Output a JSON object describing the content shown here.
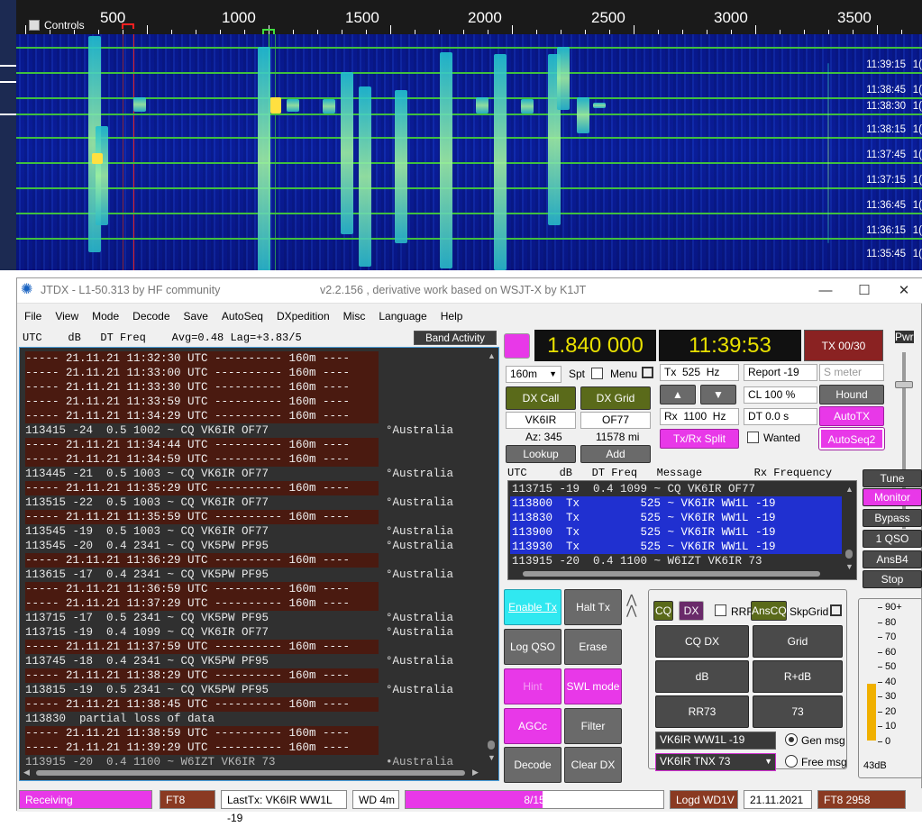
{
  "waterfall": {
    "controls_label": "Controls",
    "ticks": [
      "500",
      "1000",
      "1500",
      "2000",
      "2500",
      "3000",
      "3500"
    ],
    "times": [
      "11:39:15",
      "11:38:45",
      "11:38:30",
      "11:38:15",
      "11:37:45",
      "11:37:15",
      "11:36:45",
      "11:36:15",
      "11:35:45"
    ],
    "time_suffix": "1("
  },
  "window": {
    "title": "JTDX - L1-50.313  by HF community",
    "subtitle": "v2.2.156 , derivative work based on WSJT-X by K1JT",
    "minimize": "—",
    "maximize": "☐",
    "close": "✕"
  },
  "menu": [
    "File",
    "View",
    "Mode",
    "Decode",
    "Save",
    "AutoSeq",
    "DXpedition",
    "Misc",
    "Language",
    "Help"
  ],
  "decode_panel": {
    "header": "UTC    dB   DT Freq    Avg=0.48 Lag=+3.83/5",
    "band_activity": "Band Activity",
    "lines": [
      {
        "text": "----- 21.11.21 11:32:30 UTC ---------- 160m ----",
        "sep": true,
        "country": ""
      },
      {
        "text": "----- 21.11.21 11:33:00 UTC ---------- 160m ----",
        "sep": true,
        "country": ""
      },
      {
        "text": "----- 21.11.21 11:33:30 UTC ---------- 160m ----",
        "sep": true,
        "country": ""
      },
      {
        "text": "----- 21.11.21 11:33:59 UTC ---------- 160m ----",
        "sep": true,
        "country": ""
      },
      {
        "text": "----- 21.11.21 11:34:29 UTC ---------- 160m ----",
        "sep": true,
        "country": ""
      },
      {
        "text": "113415 -24  0.5 1002 ~ CQ VK6IR OF77",
        "sep": false,
        "country": "°Australia"
      },
      {
        "text": "----- 21.11.21 11:34:44 UTC ---------- 160m ----",
        "sep": true,
        "country": ""
      },
      {
        "text": "----- 21.11.21 11:34:59 UTC ---------- 160m ----",
        "sep": true,
        "country": ""
      },
      {
        "text": "113445 -21  0.5 1003 ~ CQ VK6IR OF77",
        "sep": false,
        "country": "°Australia"
      },
      {
        "text": "----- 21.11.21 11:35:29 UTC ---------- 160m ----",
        "sep": true,
        "country": ""
      },
      {
        "text": "113515 -22  0.5 1003 ~ CQ VK6IR OF77",
        "sep": false,
        "country": "°Australia"
      },
      {
        "text": "----- 21.11.21 11:35:59 UTC ---------- 160m ----",
        "sep": true,
        "country": ""
      },
      {
        "text": "113545 -19  0.5 1003 ~ CQ VK6IR OF77",
        "sep": false,
        "country": "°Australia"
      },
      {
        "text": "113545 -20  0.4 2341 ~ CQ VK5PW PF95",
        "sep": false,
        "country": "°Australia"
      },
      {
        "text": "----- 21.11.21 11:36:29 UTC ---------- 160m ----",
        "sep": true,
        "country": ""
      },
      {
        "text": "113615 -17  0.4 2341 ~ CQ VK5PW PF95",
        "sep": false,
        "country": "°Australia"
      },
      {
        "text": "----- 21.11.21 11:36:59 UTC ---------- 160m ----",
        "sep": true,
        "country": ""
      },
      {
        "text": "----- 21.11.21 11:37:29 UTC ---------- 160m ----",
        "sep": true,
        "country": ""
      },
      {
        "text": "113715 -17  0.5 2341 ~ CQ VK5PW PF95",
        "sep": false,
        "country": "°Australia"
      },
      {
        "text": "113715 -19  0.4 1099 ~ CQ VK6IR OF77",
        "sep": false,
        "country": "°Australia"
      },
      {
        "text": "----- 21.11.21 11:37:59 UTC ---------- 160m ----",
        "sep": true,
        "country": ""
      },
      {
        "text": "113745 -18  0.4 2341 ~ CQ VK5PW PF95",
        "sep": false,
        "country": "°Australia"
      },
      {
        "text": "----- 21.11.21 11:38:29 UTC ---------- 160m ----",
        "sep": true,
        "country": ""
      },
      {
        "text": "113815 -19  0.5 2341 ~ CQ VK5PW PF95",
        "sep": false,
        "country": "°Australia"
      },
      {
        "text": "----- 21.11.21 11:38:45 UTC ---------- 160m ----",
        "sep": true,
        "country": ""
      },
      {
        "text": "113830  partial loss of data",
        "sep": false,
        "country": ""
      },
      {
        "text": "----- 21.11.21 11:38:59 UTC ---------- 160m ----",
        "sep": true,
        "country": ""
      },
      {
        "text": "----- 21.11.21 11:39:29 UTC ---------- 160m ----",
        "sep": true,
        "country": ""
      },
      {
        "text": "113915 -20  0.4 1100 ~ W6IZT VK6IR 73",
        "sep": false,
        "country": "•Australia"
      }
    ]
  },
  "radio": {
    "frequency": "1.840 000",
    "clock": "11:39:53",
    "tx_counter": "TX 00/30",
    "band": "160m",
    "spt": "Spt",
    "menu": "Menu",
    "tx_freq": "Tx  525  Hz",
    "rx_freq": "Rx  1100  Hz",
    "report": "Report -19",
    "s_meter": "S meter",
    "cl": "CL  100 %",
    "dt": "DT 0.0 s",
    "hound": "Hound",
    "auto_tx": "AutoTX",
    "auto_seq2": "AutoSeq2",
    "wanted": "Wanted",
    "tx_rx_split": "Tx/Rx Split",
    "dx_call_btn": "DX Call",
    "dx_grid_btn": "DX Grid",
    "dx_call": "VK6IR",
    "dx_grid": "OF77",
    "az": "Az: 345",
    "distance": "11578 mi",
    "lookup": "Lookup",
    "add": "Add",
    "up_arrow": "▲",
    "down_arrow": "▼"
  },
  "msg_panel": {
    "header": "UTC     dB   DT Freq   Message        Rx Frequency",
    "lines": [
      {
        "text": "113715 -19  0.4 1099 ~ CQ VK6IR OF77",
        "tx": false
      },
      {
        "text": "113800  Tx         525 ~ VK6IR WW1L -19",
        "tx": true
      },
      {
        "text": "113830  Tx         525 ~ VK6IR WW1L -19",
        "tx": true
      },
      {
        "text": "113900  Tx         525 ~ VK6IR WW1L -19",
        "tx": true
      },
      {
        "text": "113930  Tx         525 ~ VK6IR WW1L -19",
        "tx": true
      },
      {
        "text": "113915 -20  0.4 1100 ~ W6IZT VK6IR 73",
        "tx": false
      }
    ]
  },
  "side": {
    "pwr": "Pwr",
    "tune": "Tune",
    "monitor": "Monitor",
    "bypass": "Bypass",
    "one_qso": "1 QSO",
    "ansb4": "AnsB4",
    "stop": "Stop"
  },
  "bottom_buttons": {
    "enable_tx": "Enable Tx",
    "halt_tx": "Halt Tx",
    "log_qso": "Log QSO",
    "erase": "Erase",
    "hint": "Hint",
    "swl_mode": "SWL mode",
    "agcc": "AGCc",
    "filter": "Filter",
    "decode": "Decode",
    "clear_dx": "Clear DX"
  },
  "msg_gen": {
    "cq": "CQ",
    "dx": "DX",
    "rrr": "RRR",
    "ans_cq": "AnsCQ",
    "skp_grid": "SkpGrid",
    "cq_dx": "CQ DX",
    "grid": "Grid",
    "db": "dB",
    "r_db": "R+dB",
    "rr73": "RR73",
    "seventy_three": "73",
    "tx_msg1": "VK6IR WW1L -19",
    "tx_msg2": "VK6IR TNX 73",
    "gen_msg": "Gen msg",
    "free_msg": "Free msg"
  },
  "smeter": {
    "labels": [
      "90+",
      "80",
      "70",
      "60",
      "50",
      "40",
      "30",
      "20",
      "10",
      "0"
    ],
    "value_label": "43dB",
    "level": 0.43
  },
  "status": {
    "receiving": "Receiving",
    "mode": "FT8",
    "last_tx": "LastTx: VK6IR WW1L -19",
    "wd": "WD 4m",
    "progress": "8/15",
    "progress_fraction": 0.53,
    "logd": "Logd WD1V",
    "date": "21.11.2021",
    "mode_count": "FT8  2958"
  }
}
